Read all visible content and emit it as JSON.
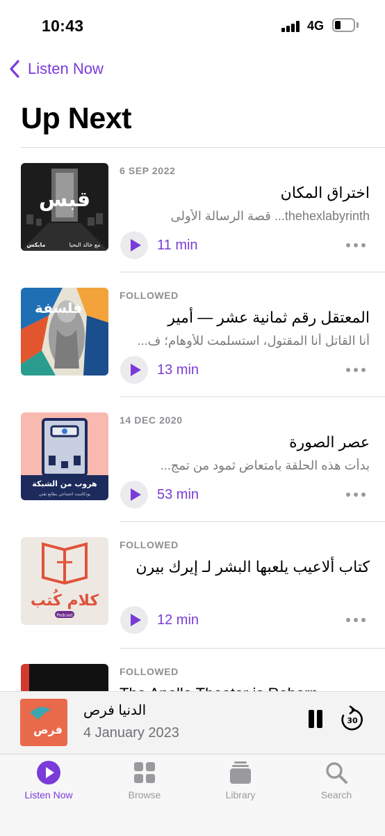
{
  "status_bar": {
    "time": "10:43",
    "network": "4G"
  },
  "nav": {
    "back_label": "Listen Now"
  },
  "page": {
    "title": "Up Next"
  },
  "episodes": [
    {
      "meta": "6 SEP 2022",
      "title": "اختراق المكان",
      "description": "thehexlabyrinth... قصة الرسالة الأولى",
      "duration": "11 min",
      "artwork": "qabas-podcast-artwork"
    },
    {
      "meta": "FOLLOWED",
      "title": "المعتقل رقم ثمانية عشر — أمير",
      "description": "أنا القاتل أنا المقتول، استسلمت للأوهام؛ ف...",
      "duration": "13 min",
      "artwork": "falsafa-podcast-artwork"
    },
    {
      "meta": "14 DEC 2020",
      "title": "عصر الصورة",
      "description": "بدأت هذه الحلقة بامتعاض ثمود من تمج...",
      "duration": "53 min",
      "artwork": "hroob-min-alshabaka-artwork"
    },
    {
      "meta": "FOLLOWED",
      "title": "كتاب ألاعيب يلعبها البشر لـ إيرك بيرن",
      "description": "",
      "duration": "12 min",
      "artwork": "kalam-kutub-artwork"
    },
    {
      "meta": "FOLLOWED",
      "title": "The Apollo Theater is Reborn",
      "description": "",
      "duration": "",
      "artwork": "apollo-artwork"
    }
  ],
  "artwork_text": {
    "qabas_title": "قبس",
    "qabas_host": "مع خالد البحيا",
    "qabas_brand": "مابكس",
    "shabaka_title": "هروب من الشبكة",
    "shabaka_sub": "بودكاست اجتماعي بطابع تقني",
    "kalam_title": "كلام كُتب",
    "kalam_badge": "Podcast"
  },
  "now_playing": {
    "title": "الدنيا فرص",
    "date": "4 January 2023",
    "skip_seconds": "30"
  },
  "tabs": [
    {
      "label": "Listen Now",
      "icon": "play-circle-icon",
      "active": true
    },
    {
      "label": "Browse",
      "icon": "grid-icon",
      "active": false
    },
    {
      "label": "Library",
      "icon": "stack-icon",
      "active": false
    },
    {
      "label": "Search",
      "icon": "magnifying-glass-icon",
      "active": false
    }
  ],
  "colors": {
    "accent": "#7a3bd8",
    "secondary_text": "#8e8e93",
    "divider": "#dcdcdc"
  }
}
